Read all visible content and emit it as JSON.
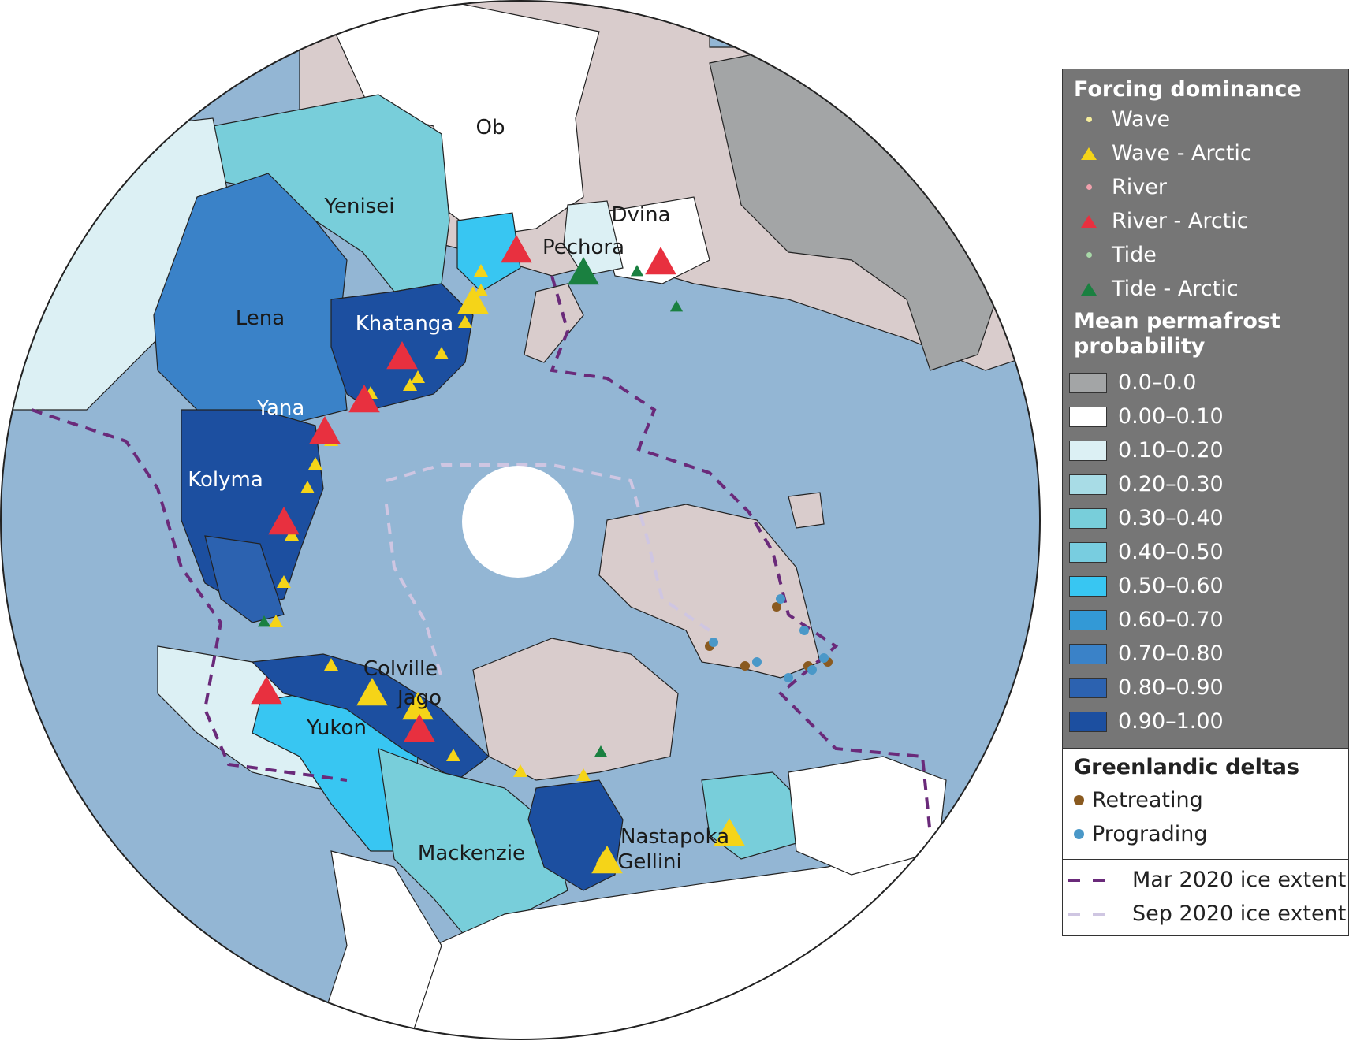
{
  "map": {
    "labels": {
      "ob": "Ob",
      "yenisei": "Yenisei",
      "dvina": "Dvina",
      "pechora": "Pechora",
      "lena": "Lena",
      "khatanga": "Khatanga",
      "yana": "Yana",
      "kolyma": "Kolyma",
      "colville": "Colville",
      "jago": "Jago",
      "yukon": "Yukon",
      "mackenzie": "Mackenzie",
      "nastapoka": "Nastapoka",
      "gellini": "Gellini"
    },
    "colors": {
      "ocean": "#93b6d4",
      "land": "#d9cccc",
      "pole_hole": "#ffffff",
      "coast_wave_band": "#f4ec9a",
      "basin_outline": "#222222"
    }
  },
  "legend": {
    "forcing": {
      "title": "Forcing dominance",
      "items": [
        {
          "label": "Wave",
          "shape": "dot",
          "color": "#f6ee9c"
        },
        {
          "label": "Wave - Arctic",
          "shape": "triangle",
          "color": "#f5d418"
        },
        {
          "label": "River",
          "shape": "dot",
          "color": "#f0a0ac"
        },
        {
          "label": "River - Arctic",
          "shape": "triangle",
          "color": "#e8303f"
        },
        {
          "label": "Tide",
          "shape": "dot",
          "color": "#a8d8a8"
        },
        {
          "label": "Tide - Arctic",
          "shape": "triangle",
          "color": "#1a8040"
        }
      ]
    },
    "permafrost": {
      "title_line1": "Mean permafrost",
      "title_line2": "probability",
      "items": [
        {
          "label": "0.0–0.0",
          "color": "#a3a5a6"
        },
        {
          "label": "0.00–0.10",
          "color": "#ffffff"
        },
        {
          "label": "0.10–0.20",
          "color": "#dcf0f4"
        },
        {
          "label": "0.20–0.30",
          "color": "#a8dce6"
        },
        {
          "label": "0.30–0.40",
          "color": "#78ceda"
        },
        {
          "label": "0.40–0.50",
          "color": "#78cde0"
        },
        {
          "label": "0.50–0.60",
          "color": "#38c6f2"
        },
        {
          "label": "0.60–0.70",
          "color": "#3399d6"
        },
        {
          "label": "0.70–0.80",
          "color": "#3a82c8"
        },
        {
          "label": "0.80–0.90",
          "color": "#2c62b0"
        },
        {
          "label": "0.90–1.00",
          "color": "#1c4fa0"
        }
      ]
    },
    "greenland": {
      "title": "Greenlandic deltas",
      "items": [
        {
          "label": "Retreating",
          "color": "#8a5a20"
        },
        {
          "label": "Prograding",
          "color": "#4a98c8"
        }
      ]
    },
    "ice": {
      "items": [
        {
          "label": "Mar 2020  ice extent",
          "color": "#6a2a7a"
        },
        {
          "label": "Sep 2020 ice extent",
          "color": "#cfc6e2"
        }
      ]
    }
  }
}
